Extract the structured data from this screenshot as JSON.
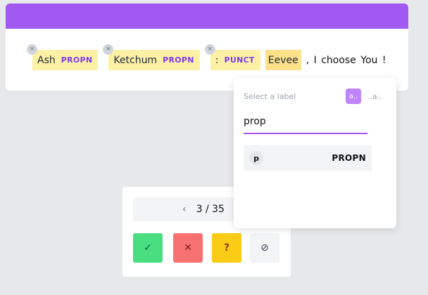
{
  "tokens": [
    {
      "text": "Ash",
      "label": "PROPN"
    },
    {
      "text": "Ketchum",
      "label": "PROPN"
    },
    {
      "text": ":",
      "label": "PUNCT"
    }
  ],
  "selected_token": "Eevee",
  "trailing_text": ", I choose You !",
  "remove_glyph": "×",
  "pager": {
    "prev_icon": "chevron-left-icon",
    "prev_glyph": "‹",
    "text": "3 / 35"
  },
  "actions": {
    "accept_glyph": "✓",
    "reject_glyph": "✕",
    "flag_glyph": "?",
    "ignore_glyph": "⊘"
  },
  "label_picker": {
    "title": "Select a label",
    "swatch_a": "a..",
    "swatch_b": "..a..",
    "query": "prop",
    "options": [
      {
        "key": "p",
        "label": "PROPN"
      }
    ]
  },
  "colors": {
    "header": "#a259f2",
    "token_bg": "#fdf1a5",
    "selected_bg": "#fde18a",
    "accent": "#a855f7"
  }
}
